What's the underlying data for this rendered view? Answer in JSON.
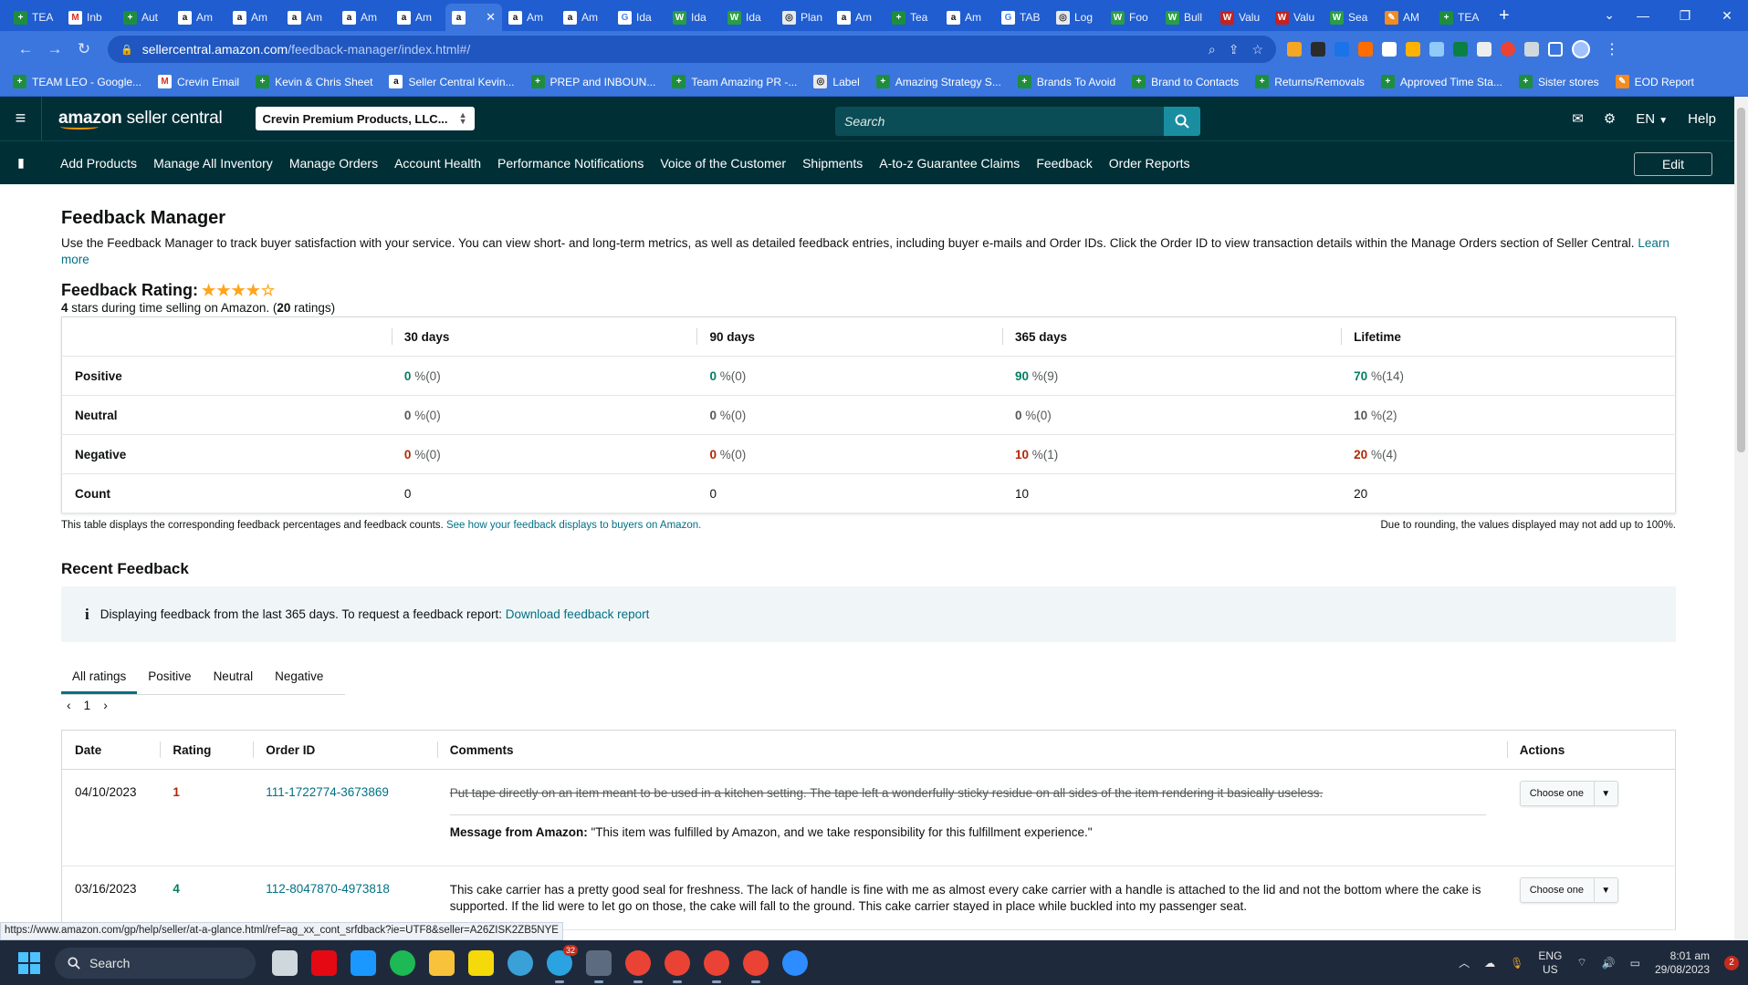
{
  "browser": {
    "tabs": [
      {
        "label": "TEA",
        "icon": "sheets"
      },
      {
        "label": "Inb",
        "icon": "gmail"
      },
      {
        "label": "Aut",
        "icon": "sheets"
      },
      {
        "label": "Am",
        "icon": "amazon"
      },
      {
        "label": "Am",
        "icon": "amazon"
      },
      {
        "label": "Am",
        "icon": "amazon"
      },
      {
        "label": "Am",
        "icon": "amazon"
      },
      {
        "label": "Am",
        "icon": "amazon"
      },
      {
        "label": "",
        "icon": "amazon",
        "active": true
      },
      {
        "label": "Am",
        "icon": "amazon"
      },
      {
        "label": "Am",
        "icon": "amazon"
      },
      {
        "label": "Ida",
        "icon": "google"
      },
      {
        "label": "Ida",
        "icon": "green"
      },
      {
        "label": "Ida",
        "icon": "green"
      },
      {
        "label": "Plan",
        "icon": "gray"
      },
      {
        "label": "Am",
        "icon": "amazon"
      },
      {
        "label": "Tea",
        "icon": "sheets"
      },
      {
        "label": "Am",
        "icon": "amazon"
      },
      {
        "label": "TAB",
        "icon": "google"
      },
      {
        "label": "Log",
        "icon": "gray"
      },
      {
        "label": "Foo",
        "icon": "green"
      },
      {
        "label": "Bull",
        "icon": "green"
      },
      {
        "label": "Valu",
        "icon": "red"
      },
      {
        "label": "Valu",
        "icon": "red"
      },
      {
        "label": "Sea",
        "icon": "green"
      },
      {
        "label": "AM",
        "icon": "orange"
      },
      {
        "label": "TEA",
        "icon": "sheets"
      }
    ],
    "url_host": "sellercentral.amazon.com",
    "url_path": "/feedback-manager/index.html#/",
    "bookmarks": [
      {
        "label": "TEAM LEO - Google...",
        "icon": "sheets"
      },
      {
        "label": "Crevin Email",
        "icon": "gmail"
      },
      {
        "label": "Kevin & Chris Sheet",
        "icon": "sheets"
      },
      {
        "label": "Seller Central Kevin...",
        "icon": "amazon"
      },
      {
        "label": "PREP and INBOUN...",
        "icon": "sheets"
      },
      {
        "label": "Team Amazing PR -...",
        "icon": "sheets"
      },
      {
        "label": "Label",
        "icon": "gray"
      },
      {
        "label": "Amazing Strategy S...",
        "icon": "sheets"
      },
      {
        "label": "Brands To Avoid",
        "icon": "sheets"
      },
      {
        "label": "Brand to Contacts",
        "icon": "sheets"
      },
      {
        "label": "Returns/Removals",
        "icon": "sheets"
      },
      {
        "label": "Approved Time Sta...",
        "icon": "sheets"
      },
      {
        "label": "Sister stores",
        "icon": "sheets"
      },
      {
        "label": "EOD Report",
        "icon": "orange"
      }
    ]
  },
  "header": {
    "logo_bold": "amazon",
    "logo_rest": " seller central",
    "account": "Crevin Premium Products, LLC...",
    "search_placeholder": "Search",
    "language": "EN",
    "help": "Help"
  },
  "nav": {
    "items": [
      "Add Products",
      "Manage All Inventory",
      "Manage Orders",
      "Account Health",
      "Performance Notifications",
      "Voice of the Customer",
      "Shipments",
      "A-to-z Guarantee Claims",
      "Feedback",
      "Order Reports"
    ],
    "edit": "Edit"
  },
  "page": {
    "title": "Feedback Manager",
    "intro": "Use the Feedback Manager to track buyer satisfaction with your service. You can view short- and long-term metrics, as well as detailed feedback entries, including buyer e-mails and Order IDs. Click the Order ID to view transaction details within the Manage Orders section of Seller Central.",
    "learn_more": "Learn more",
    "rating_label": "Feedback Rating:",
    "rating_stars": 4,
    "rating_sub_stars": "4",
    "rating_sub_mid": " stars during time selling on Amazon. (",
    "rating_sub_count": "20",
    "rating_sub_end": " ratings)"
  },
  "metrics": {
    "columns": [
      "30 days",
      "90 days",
      "365 days",
      "Lifetime"
    ],
    "rows": [
      {
        "label": "Positive",
        "type": "pos",
        "cells": [
          {
            "v": "0",
            "n": "%(0)"
          },
          {
            "v": "0",
            "n": "%(0)"
          },
          {
            "v": "90",
            "n": "%(9)"
          },
          {
            "v": "70",
            "n": "%(14)"
          }
        ]
      },
      {
        "label": "Neutral",
        "type": "neu",
        "cells": [
          {
            "v": "0",
            "n": "%(0)"
          },
          {
            "v": "0",
            "n": "%(0)"
          },
          {
            "v": "0",
            "n": "%(0)"
          },
          {
            "v": "10",
            "n": "%(2)"
          }
        ]
      },
      {
        "label": "Negative",
        "type": "neg",
        "cells": [
          {
            "v": "0",
            "n": "%(0)"
          },
          {
            "v": "0",
            "n": "%(0)"
          },
          {
            "v": "10",
            "n": "%(1)"
          },
          {
            "v": "20",
            "n": "%(4)"
          }
        ]
      },
      {
        "label": "Count",
        "type": "count",
        "cells": [
          {
            "v": "0"
          },
          {
            "v": "0"
          },
          {
            "v": "10"
          },
          {
            "v": "20"
          }
        ]
      }
    ],
    "note": "This table displays the corresponding feedback percentages and feedback counts.",
    "note_link": "See how your feedback displays to buyers on Amazon.",
    "rounding_note": "Due to rounding, the values displayed may not add up to 100%."
  },
  "recent": {
    "title": "Recent Feedback",
    "info": "Displaying feedback from the last 365 days. To request a feedback report:",
    "info_link": "Download feedback report",
    "tabs": [
      "All ratings",
      "Positive",
      "Neutral",
      "Negative"
    ],
    "active_tab": "All ratings",
    "page": "1",
    "columns": [
      "Date",
      "Rating",
      "Order ID",
      "Comments",
      "Actions"
    ],
    "rows": [
      {
        "date": "04/10/2023",
        "rating": "1",
        "rating_type": "neg",
        "order_id": "111-1722774-3673869",
        "comment": "Put tape directly on an item meant to be used in a kitchen setting. The tape left a wonderfully sticky residue on all sides of the item rendering it basically useless.",
        "struck": true,
        "amazon_label": "Message from Amazon:",
        "amazon_message": "\"This item was fulfilled by Amazon, and we take responsibility for this fulfillment experience.\"",
        "action": "Choose one"
      },
      {
        "date": "03/16/2023",
        "rating": "4",
        "rating_type": "pos",
        "order_id": "112-8047870-4973818",
        "comment": "This cake carrier has a pretty good seal for freshness. The lack of handle is fine with me as almost every cake carrier with a handle is attached to the lid and not the bottom where the cake is supported. If the lid were to let go on those, the cake will fall to the ground. This cake carrier stayed in place while buckled into my passenger seat.",
        "struck": false,
        "action": "Choose one"
      }
    ]
  },
  "status_url": "https://www.amazon.com/gp/help/seller/at-a-glance.html/ref=ag_xx_cont_srfdback?ie=UTF8&seller=A26ZISK2ZB5NYE",
  "taskbar": {
    "search": "Search",
    "lang_top": "ENG",
    "lang_bottom": "US",
    "time": "8:01 am",
    "date": "29/08/2023",
    "notifications": "2",
    "telegram_badge": "32",
    "apps": [
      "task-view",
      "netflix",
      "prime-video",
      "spotify",
      "file-explorer",
      "sticky-notes",
      "world-globe",
      "telegram",
      "calculator",
      "chrome",
      "chrome",
      "chrome",
      "chrome",
      "zoom"
    ]
  },
  "colors": {
    "chrome_tabstrip": "#1f5dd0",
    "chrome_toolbar": "#3b76de",
    "sc_header": "#002f36",
    "positive": "#067d62",
    "negative": "#b12704",
    "link": "#007185",
    "star": "#ffa41c"
  }
}
